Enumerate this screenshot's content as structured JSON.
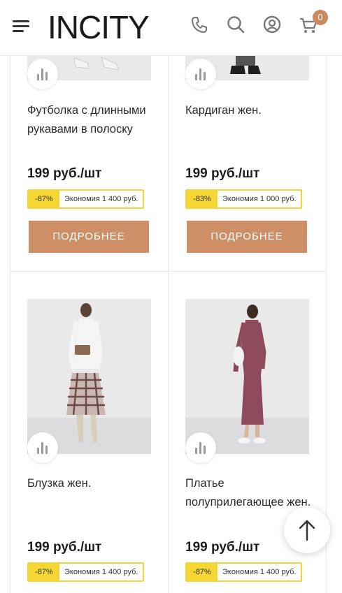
{
  "header": {
    "logo": "INCITY",
    "cart_count": "0",
    "icons": [
      "menu-icon",
      "phone-icon",
      "search-icon",
      "account-icon",
      "cart-icon"
    ]
  },
  "products": [
    {
      "name": "Футболка с длинными рукавами в полоску",
      "price": "199 руб./шт",
      "discount": "-87%",
      "economy": "Экономия 1 400 руб.",
      "button": "ПОДРОБНЕЕ"
    },
    {
      "name": "Кардиган жен.",
      "price": "199 руб./шт",
      "discount": "-83%",
      "economy": "Экономия 1 000 руб.",
      "button": "ПОДРОБНЕЕ"
    },
    {
      "name": "Блузка жен.",
      "price": "199 руб./шт",
      "discount": "-87%",
      "economy": "Экономия 1 400 руб."
    },
    {
      "name": "Платье полуприлегающее жен.",
      "price": "199 руб./шт",
      "discount": "-87%",
      "economy": "Экономия 1 400 руб."
    }
  ],
  "colors": {
    "button": "#cf8f66",
    "discount": "#f6d632",
    "badge": "#c98a5e"
  }
}
